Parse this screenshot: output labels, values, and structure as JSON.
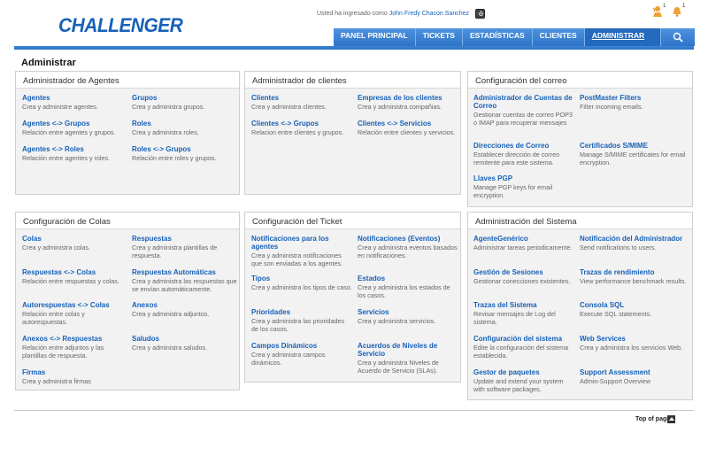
{
  "header": {
    "logo": "CHALLENGER",
    "logged_prefix": "Usted ha ingresado como",
    "user_name": "John Fredy Chacon Sanchez",
    "notif_1_count": "1",
    "notif_2_count": "1",
    "accent_color": "#1761b8"
  },
  "nav": {
    "items": [
      "PANEL PRINCIPAL",
      "TICKETS",
      "ESTADÍSTICAS",
      "CLIENTES",
      "ADMINISTRAR"
    ],
    "active": "ADMINISTRAR",
    "search_icon": "search-icon"
  },
  "page_title": "Administrar",
  "panels": [
    {
      "title": "Administrador de Agentes",
      "items": [
        {
          "t": "Agentes",
          "d": "Crea y administre agentes."
        },
        {
          "t": "Grupos",
          "d": "Crea y administra grupos."
        },
        {
          "t": "Agentes <-> Grupos",
          "d": "Relación entre agentes y grupos."
        },
        {
          "t": "Roles",
          "d": "Crea y administra roles."
        },
        {
          "t": "Agentes <-> Roles",
          "d": "Relación entre agentes y roles."
        },
        {
          "t": "Roles <-> Grupos",
          "d": "Relación entre roles y grupos."
        }
      ]
    },
    {
      "title": "Administrador de clientes",
      "items": [
        {
          "t": "Clientes",
          "d": "Crea y administra clientes."
        },
        {
          "t": "Empresas de los clientes",
          "d": "Crea y administra compañias."
        },
        {
          "t": "Clientes <-> Grupos",
          "d": "Relacion entre clientes y grupos."
        },
        {
          "t": "Clientes <-> Servicios",
          "d": "Relación entre clientes y servicios."
        }
      ]
    },
    {
      "title": "Configuración del correo",
      "items": [
        {
          "t": "Administrador de Cuentas de Correo",
          "d": "Gestionar cuentas de correo POP3 o IMAP para recuperar mensajes"
        },
        {
          "t": "PostMaster Filters",
          "d": "Filter incoming emails."
        },
        {
          "t": "Direcciones de Correo",
          "d": "Establecer dirección de correo remitente para este sistema."
        },
        {
          "t": "Certificados S/MIME",
          "d": "Manage S/MIME certificates for email encryption."
        },
        {
          "t": "Llaves PGP",
          "d": "Manage PGP keys for email encryption."
        }
      ]
    },
    {
      "title": "Configuración de Colas",
      "items": [
        {
          "t": "Colas",
          "d": "Crea y administra colas."
        },
        {
          "t": "Respuestas",
          "d": "Crea y administra plantillas de respuesta."
        },
        {
          "t": "Respuestas <-> Colas",
          "d": "Relación entre respuestas y colas."
        },
        {
          "t": "Respuestas Automáticas",
          "d": "Crea y administra las respuestas que se envían automáticamente."
        },
        {
          "t": "Autorespuestas <-> Colas",
          "d": "Relación entre colas y autorespuestas."
        },
        {
          "t": "Anexos",
          "d": "Crea y administra adjuntos."
        },
        {
          "t": "Anexos <-> Respuestas",
          "d": "Relación entre adjuntos y las plantillas de respuesta."
        },
        {
          "t": "Saludos",
          "d": "Crea y administra saludos."
        },
        {
          "t": "Firmas",
          "d": "Crea y administra firmas"
        }
      ]
    },
    {
      "title": "Configuración del Ticket",
      "items": [
        {
          "t": "Notificaciones para los agentes",
          "d": "Crea y administra notificaciones que son enviadas a los agentes."
        },
        {
          "t": "Notificaciones (Eventos)",
          "d": "Crea y administra eventos basados en notificaciones."
        },
        {
          "t": "Tipos",
          "d": "Crea y administra los tipos de caso."
        },
        {
          "t": "Estados",
          "d": "Crea y administra los estados de los casos."
        },
        {
          "t": "Prioridades",
          "d": "Crea y administra las prioridades de los casos."
        },
        {
          "t": "Servicios",
          "d": "Crea y administra servicios."
        },
        {
          "t": "Campos Dinámicos",
          "d": "Crea y administra campos dinámicos."
        },
        {
          "t": "Acuerdos de Niveles de Servicio",
          "d": "Crea y administra Niveles de Acuerdo de Servicio (SLAs)."
        }
      ]
    },
    {
      "title": "Administración del Sistema",
      "items": [
        {
          "t": "AgenteGenérico",
          "d": "Administrar tareas periodicamente."
        },
        {
          "t": "Notificación del Administrador",
          "d": "Send notifications to users."
        },
        {
          "t": "Gestión de Sesiones",
          "d": "Gestionar conecciones existentes."
        },
        {
          "t": "Trazas de rendimiento",
          "d": "View performance benchmark results."
        },
        {
          "t": "Trazas del Sistema",
          "d": "Revisar mensajes de Log del sistema."
        },
        {
          "t": "Consola SQL",
          "d": "Execute SQL statements."
        },
        {
          "t": "Configuración del sistema",
          "d": "Edite la configuración del sistema establecida."
        },
        {
          "t": "Web Services",
          "d": "Crea y administra los servicios Web."
        },
        {
          "t": "Gestor de paquetes",
          "d": "Update and extend your system with software packages."
        },
        {
          "t": "Support Assessment",
          "d": "Admin-Support Overview"
        }
      ]
    }
  ],
  "footer": {
    "top_link": "Top of page"
  }
}
